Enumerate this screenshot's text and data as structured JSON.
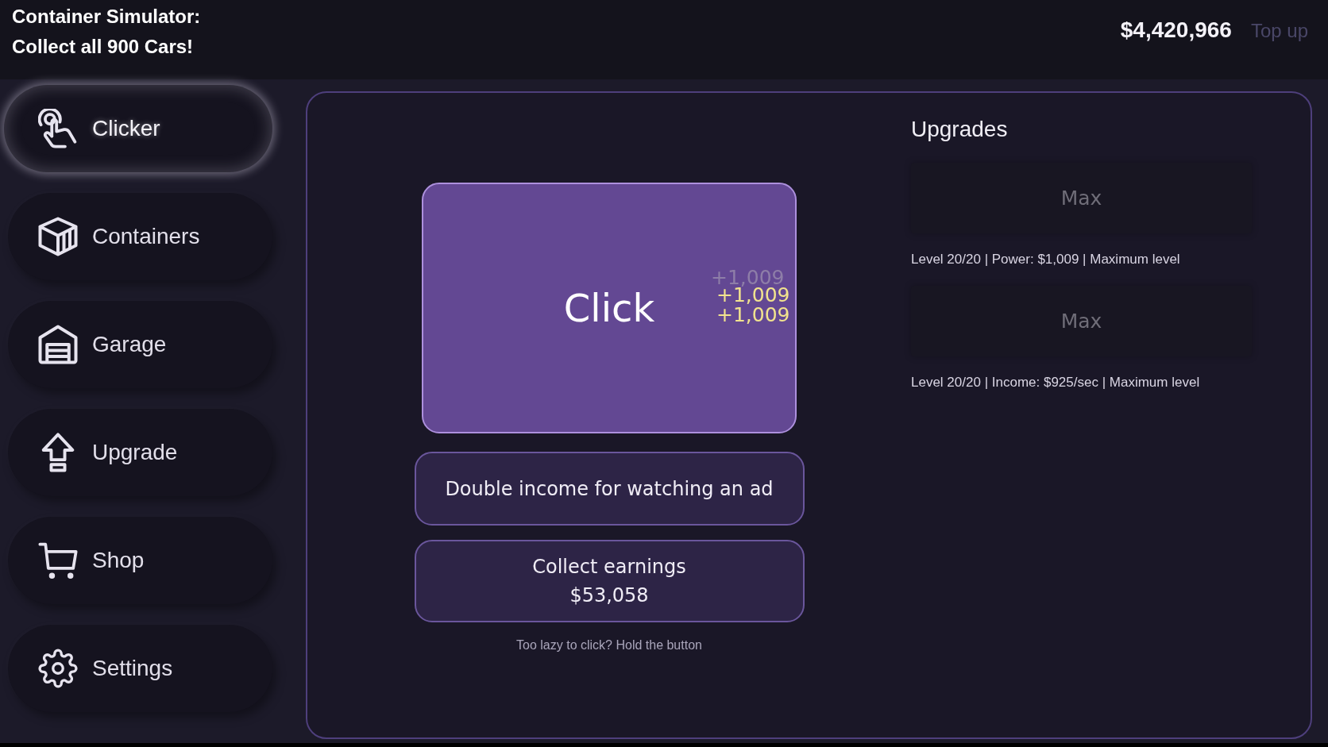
{
  "header": {
    "title": "Container Simulator: Collect all 900 Cars!",
    "balance": "$4,420,966",
    "top_up": "Top up"
  },
  "sidebar": {
    "items": [
      {
        "label": "Clicker",
        "selected": true
      },
      {
        "label": "Containers",
        "selected": false
      },
      {
        "label": "Garage",
        "selected": false
      },
      {
        "label": "Upgrade",
        "selected": false
      },
      {
        "label": "Shop",
        "selected": false
      },
      {
        "label": "Settings",
        "selected": false
      }
    ]
  },
  "clicker": {
    "click_button": "Click",
    "popups": [
      {
        "text": "+1,009",
        "fading": true
      },
      {
        "text": "+1,009",
        "fading": false
      },
      {
        "text": "+1,009",
        "fading": false
      }
    ],
    "ad_button": "Double income for watching an ad",
    "collect_button": {
      "label": "Collect earnings",
      "amount": "$53,058"
    },
    "hint": "Too lazy to click? Hold the button"
  },
  "upgrades": {
    "title": "Upgrades",
    "items": [
      {
        "button": "Max",
        "disabled": true,
        "description": "Level 20/20 | Power: $1,009 | Maximum level"
      },
      {
        "button": "Max",
        "disabled": true,
        "description": "Level 20/20 | Income: $925/sec | Maximum level"
      }
    ]
  }
}
